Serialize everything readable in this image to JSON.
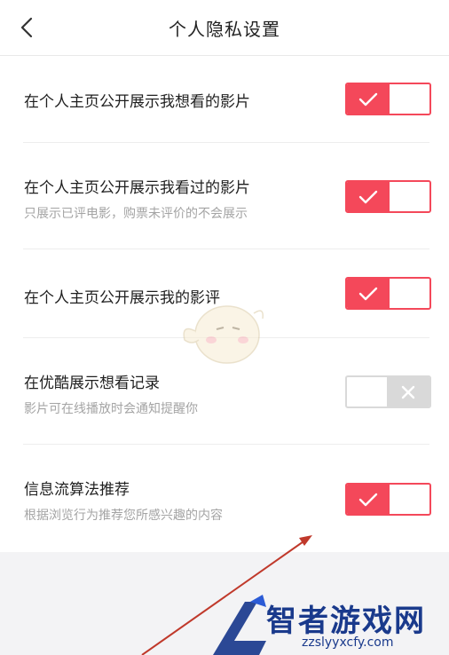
{
  "header": {
    "title": "个人隐私设置",
    "back_icon": "chevron-left-icon"
  },
  "settings": [
    {
      "title": "在个人主页公开展示我想看的影片",
      "subtitle": "",
      "enabled": true
    },
    {
      "title": "在个人主页公开展示我看过的影片",
      "subtitle": "只展示已评电影，购票未评价的不会展示",
      "enabled": true
    },
    {
      "title": "在个人主页公开展示我的影评",
      "subtitle": "",
      "enabled": true
    },
    {
      "title": "在优酷展示想看记录",
      "subtitle": "影片可在线播放时会通知提醒你",
      "enabled": false
    },
    {
      "title": "信息流算法推荐",
      "subtitle": "根据浏览行为推荐您所感兴趣的内容",
      "enabled": true
    }
  ],
  "colors": {
    "accent": "#f4485a",
    "off": "#d9d9d9",
    "footer_bg": "#f3f3f5",
    "annotation_arrow": "#c0392b"
  },
  "watermark": {
    "name": "智者游戏网",
    "url": "zzslyyxcfy.com"
  }
}
